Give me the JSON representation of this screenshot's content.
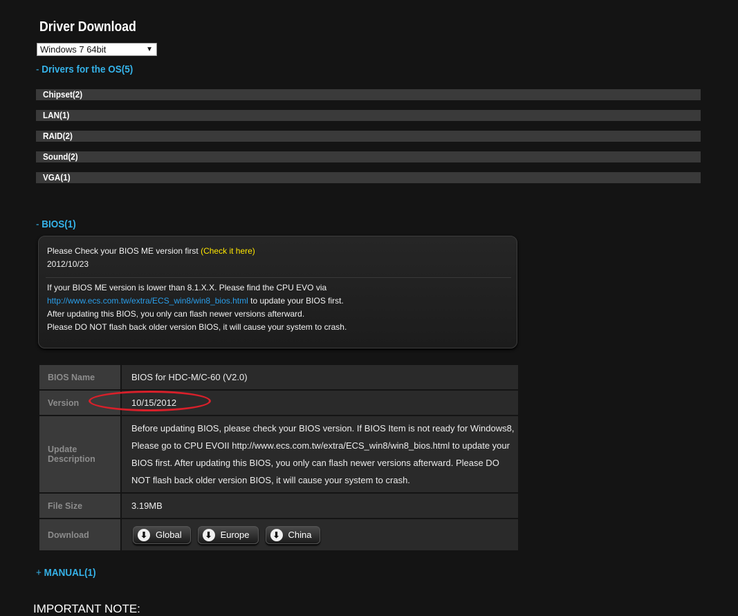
{
  "page": {
    "title": "Driver Download",
    "os_select": {
      "value": "Windows 7 64bit"
    }
  },
  "drivers_section": {
    "sign": "-",
    "label": "Drivers for the OS(5)",
    "categories": [
      "Chipset(2)",
      "LAN(1)",
      "RAID(2)",
      "Sound(2)",
      "VGA(1)"
    ]
  },
  "bios_section": {
    "sign": "-",
    "label": "BIOS(1)",
    "notice": {
      "check_text": "Please Check your BIOS ME version first",
      "check_link": "(Check it here)",
      "date": "2012/10/23",
      "line1": "If your BIOS ME version is lower than 8.1.X.X. Please find the CPU EVO via",
      "link": "http://www.ecs.com.tw/extra/ECS_win8/win8_bios.html",
      "line2_suffix": " to update your BIOS first.",
      "line3": "After updating this BIOS, you only can flash newer versions afterward.",
      "line4": "Please DO NOT flash back older version BIOS, it will cause your system to crash."
    },
    "table": {
      "name_label": "BIOS Name",
      "name_value": "BIOS for HDC-M/C-60 (V2.0)",
      "version_label": "Version",
      "version_value": "10/15/2012",
      "desc_label": "Update Description",
      "desc_value": "Before updating BIOS, please check your BIOS version. If BIOS Item is not ready for Windows8, Please go to CPU EVOII http://www.ecs.com.tw/extra/ECS_win8/win8_bios.html to update your BIOS first. After updating this BIOS, you only can flash newer versions afterward. Please DO NOT flash back older version BIOS, it will cause your system to crash.",
      "size_label": "File Size",
      "size_value": "3.19MB",
      "download_label": "Download",
      "downloads": [
        "Global",
        "Europe",
        "China"
      ]
    }
  },
  "manual_section": {
    "sign": "+",
    "label": "MANUAL(1)"
  },
  "important_note": "IMPORTANT NOTE:",
  "colors": {
    "accent": "#35b2e8",
    "highlight_circle": "#d8202a",
    "check_link": "#ffe600"
  },
  "icons": {
    "download": "download-arrow-icon",
    "dropdown": "dropdown-arrow-icon"
  }
}
